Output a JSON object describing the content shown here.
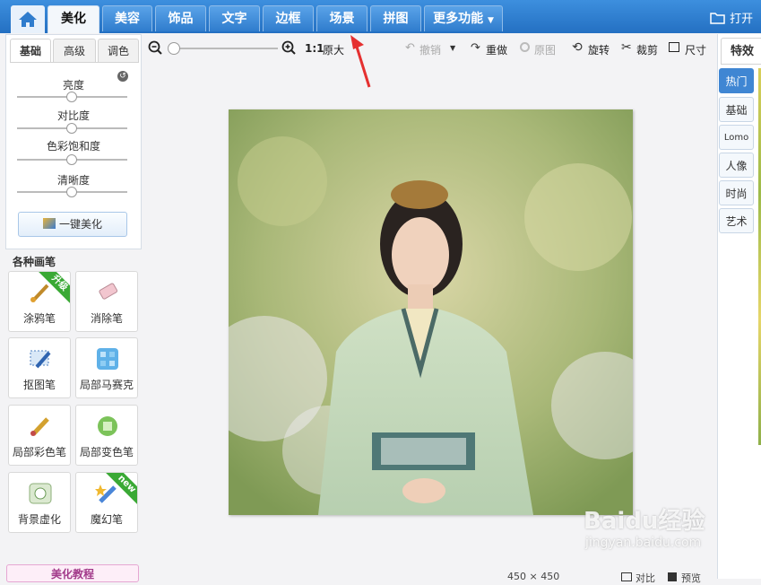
{
  "top_nav": {
    "home_icon": "home-icon",
    "tabs": [
      {
        "label": "美化",
        "active": true
      },
      {
        "label": "美容"
      },
      {
        "label": "饰品"
      },
      {
        "label": "文字"
      },
      {
        "label": "边框"
      },
      {
        "label": "场景"
      },
      {
        "label": "拼图"
      },
      {
        "label": "更多功能"
      }
    ],
    "open_label": "打开"
  },
  "toolbar": {
    "zoom_ratio": "1:1",
    "original_size_label": "原大",
    "undo_label": "撤销",
    "redo_label": "重做",
    "original_label": "原图",
    "rotate_label": "旋转",
    "crop_label": "裁剪",
    "size_label": "尺寸"
  },
  "left_panel": {
    "tabs": [
      "基础",
      "高级",
      "调色"
    ],
    "adjustments": [
      "亮度",
      "对比度",
      "色彩饱和度",
      "清晰度"
    ],
    "one_key_label": "一键美化",
    "brush_section_title": "各种画笔",
    "brushes": [
      {
        "label": "涂鸦笔",
        "badge": "升级"
      },
      {
        "label": "消除笔"
      },
      {
        "label": "抠图笔"
      },
      {
        "label": "局部马赛克"
      },
      {
        "label": "局部彩色笔"
      },
      {
        "label": "局部变色笔"
      },
      {
        "label": "背景虚化"
      },
      {
        "label": "魔幻笔",
        "badge": "new"
      }
    ],
    "tutorial_label": "美化教程"
  },
  "right_panel": {
    "title": "特效",
    "tabs": [
      "热门",
      "基础",
      "Lomo",
      "人像",
      "时尚",
      "艺术"
    ]
  },
  "status_bar": {
    "dimensions": "450 × 450",
    "compare_label": "对比",
    "preview_label": "预览"
  },
  "watermark": {
    "brand": "Baidu经验",
    "url": "jingyan.baidu.com"
  },
  "colors": {
    "nav_blue": "#2f7ccd",
    "accent": "#3f86d3",
    "annotation_arrow": "#e53030"
  }
}
